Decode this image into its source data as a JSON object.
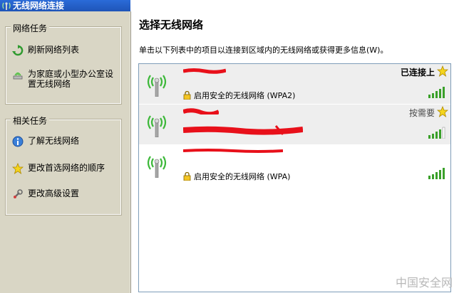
{
  "window": {
    "title": "无线网络连接"
  },
  "sidebar": {
    "network_tasks": {
      "title": "网络任务",
      "items": [
        {
          "label": "刷新网络列表",
          "icon": "refresh-icon"
        },
        {
          "label": "为家庭或小型办公室设\n置无线网络",
          "icon": "setup-wizard-icon"
        }
      ]
    },
    "related_tasks": {
      "title": "相关任务",
      "items": [
        {
          "label": "了解无线网络",
          "icon": "info-icon"
        },
        {
          "label": "更改首选网络的顺序",
          "icon": "star-icon"
        },
        {
          "label": "更改高级设置",
          "icon": "settings-icon"
        }
      ]
    }
  },
  "main": {
    "heading": "选择无线网络",
    "description": "单击以下列表中的项目以连接到区域内的无线网络或获得更多信息(W)。",
    "networks": [
      {
        "status": "已连接上",
        "security": "启用安全的无线网络 (WPA2)",
        "signal_bars": 5
      },
      {
        "status": "按需要",
        "security": "",
        "signal_bars": 4
      },
      {
        "status": "",
        "security": "启用安全的无线网络 (WPA)",
        "signal_bars": 5
      }
    ]
  },
  "watermark": "中国安全网",
  "colors": {
    "titlebar": "#2a6bd8",
    "sidebar_bg": "#d9d6c5",
    "signal_green": "#3aa02a",
    "redaction": "#e8101a"
  }
}
